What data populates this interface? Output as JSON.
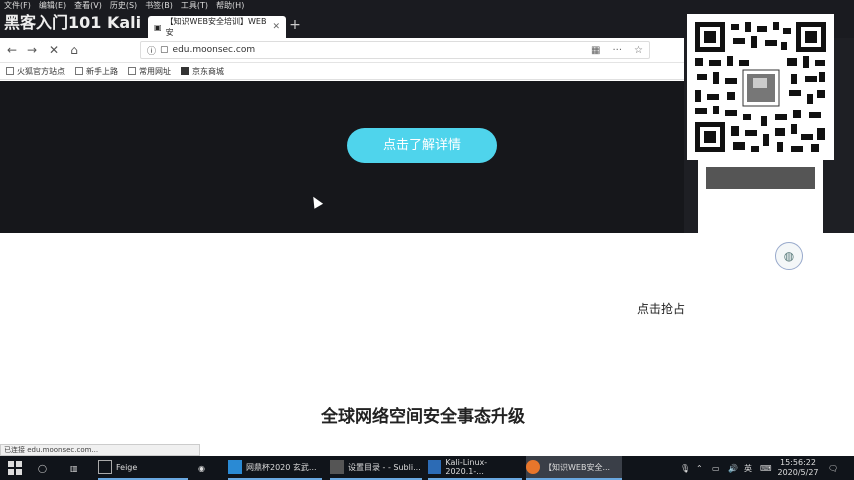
{
  "menubar": {
    "items": [
      "文件(F)",
      "编辑(E)",
      "查看(V)",
      "历史(S)",
      "书签(B)",
      "工具(T)",
      "帮助(H)"
    ]
  },
  "video_title": "黑客入门101 Kali",
  "browser": {
    "tab_title": "【知识WEB安全培训】WEB安",
    "url": "edu.moonsec.com",
    "bookmarks": [
      "火狐官方站点",
      "新手上路",
      "常用网址",
      "京东商城"
    ]
  },
  "hero": {
    "cta_label": "点击了解详情"
  },
  "side": {
    "grab_label": "点击抢占"
  },
  "section": {
    "title": "全球网络空间安全事态升级"
  },
  "status": {
    "text": "已连接 edu.moonsec.com..."
  },
  "taskbar": {
    "apps": [
      {
        "label": "Feige"
      },
      {
        "label": "网鼎杯2020 玄武..."
      },
      {
        "label": "设置目录 - - Subli..."
      },
      {
        "label": "Kali-Linux-2020.1-..."
      },
      {
        "label": "【知识WEB安全..."
      }
    ],
    "ime": "英",
    "time": "15:56:22",
    "date": "2020/5/27"
  },
  "colors": {
    "accent": "#4fd4ec",
    "hero_bg": "#16171b",
    "taskbar_bg": "#10141a"
  }
}
